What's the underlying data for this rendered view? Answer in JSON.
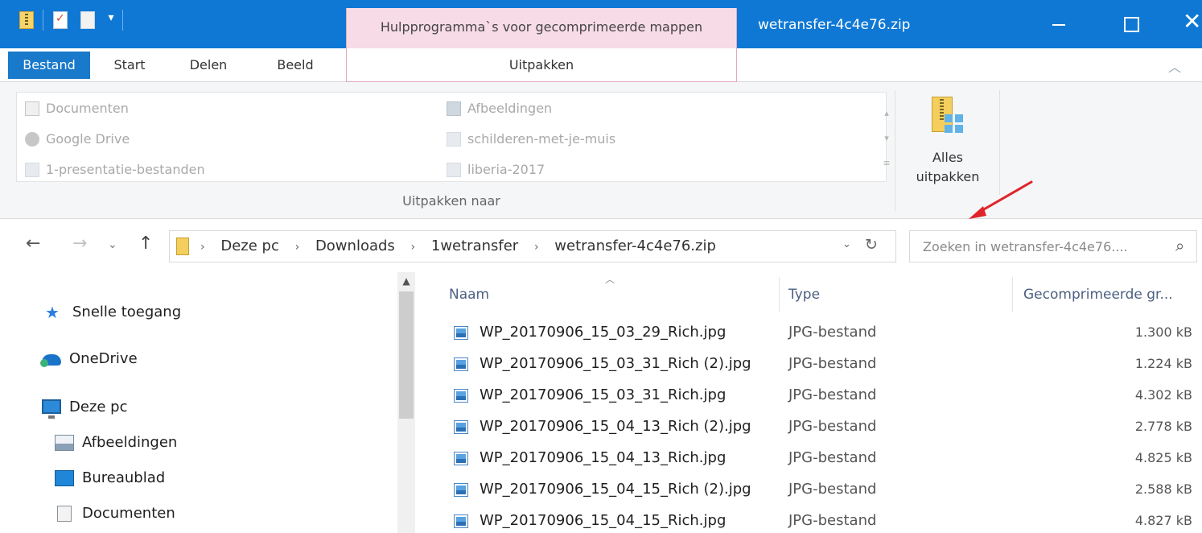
{
  "window": {
    "title": "wetransfer-4c4e76.zip",
    "tool_context": "Hulpprogramma`s voor gecomprimeerde mappen"
  },
  "ribbon_tabs": {
    "bestand": "Bestand",
    "start": "Start",
    "delen": "Delen",
    "beeld": "Beeld",
    "uitpakken": "Uitpakken"
  },
  "ribbon": {
    "destinations": [
      {
        "label": "Documenten",
        "icon": "document-folder-icon"
      },
      {
        "label": "Google Drive",
        "icon": "google-drive-icon"
      },
      {
        "label": "1-presentatie-bestanden",
        "icon": "folder-icon"
      },
      {
        "label": "Afbeeldingen",
        "icon": "pictures-folder-icon"
      },
      {
        "label": "schilderen-met-je-muis",
        "icon": "folder-icon"
      },
      {
        "label": "liberia-2017",
        "icon": "folder-icon"
      }
    ],
    "group_label": "Uitpakken naar",
    "extract_all_label": "Alles\nuitpakken"
  },
  "address": {
    "crumbs": [
      "Deze pc",
      "Downloads",
      "1wetransfer",
      "wetransfer-4c4e76.zip"
    ],
    "search_placeholder": "Zoeken in wetransfer-4c4e76...."
  },
  "nav_pane": {
    "quick_access": "Snelle toegang",
    "onedrive": "OneDrive",
    "this_pc": "Deze pc",
    "pictures": "Afbeeldingen",
    "desktop": "Bureaublad",
    "documents": "Documenten"
  },
  "file_list": {
    "columns": {
      "name": "Naam",
      "type": "Type",
      "size": "Gecomprimeerde gr..."
    },
    "rows": [
      {
        "name": "WP_20170906_15_03_29_Rich.jpg",
        "type": "JPG-bestand",
        "size": "1.300 kB"
      },
      {
        "name": "WP_20170906_15_03_31_Rich (2).jpg",
        "type": "JPG-bestand",
        "size": "1.224 kB"
      },
      {
        "name": "WP_20170906_15_03_31_Rich.jpg",
        "type": "JPG-bestand",
        "size": "4.302 kB"
      },
      {
        "name": "WP_20170906_15_04_13_Rich (2).jpg",
        "type": "JPG-bestand",
        "size": "2.778 kB"
      },
      {
        "name": "WP_20170906_15_04_13_Rich.jpg",
        "type": "JPG-bestand",
        "size": "4.825 kB"
      },
      {
        "name": "WP_20170906_15_04_15_Rich (2).jpg",
        "type": "JPG-bestand",
        "size": "2.588 kB"
      },
      {
        "name": "WP_20170906_15_04_15_Rich.jpg",
        "type": "JPG-bestand",
        "size": "4.827 kB"
      }
    ]
  },
  "colors": {
    "titlebar": "#0f78d4",
    "tool_context": "#f7dbe7",
    "accent_arrow": "#e0242a"
  }
}
